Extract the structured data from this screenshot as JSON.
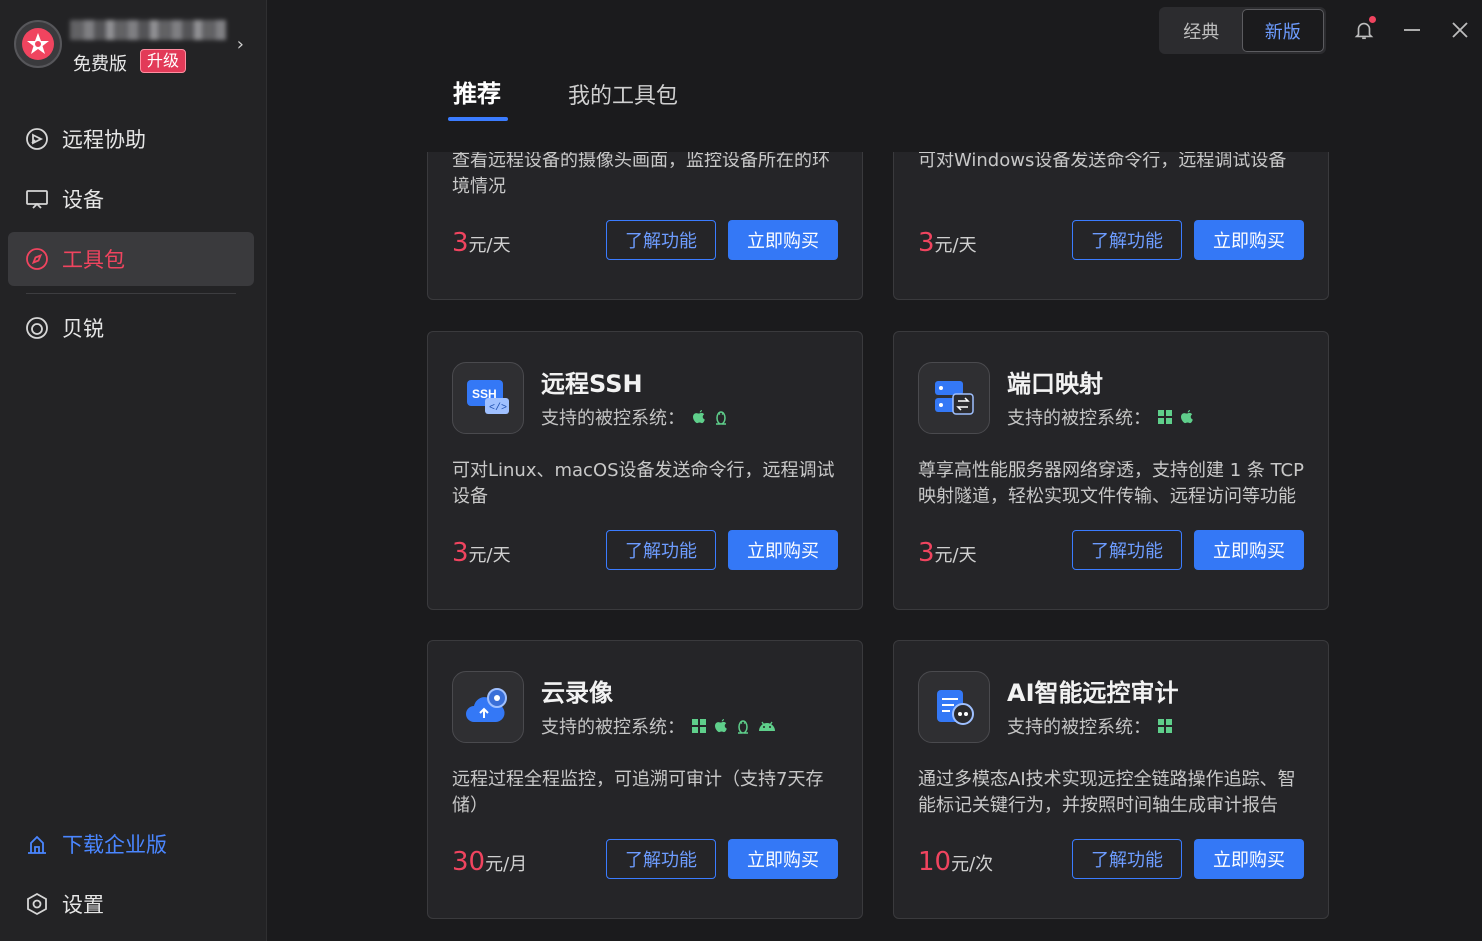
{
  "colors": {
    "accent": "#3b7cff",
    "brand": "#f0445f",
    "bg": "#1b1b1d",
    "sidebar": "#232325"
  },
  "profile": {
    "plan": "免费版",
    "upgrade": "升级"
  },
  "nav": {
    "remote_assist": "远程协助",
    "devices": "设备",
    "toolkit": "工具包",
    "beirui": "贝锐"
  },
  "bottom": {
    "download_enterprise": "下载企业版",
    "settings": "设置"
  },
  "switcher": {
    "classic": "经典",
    "new": "新版"
  },
  "tabs": {
    "recommended": "推荐",
    "my_toolkit": "我的工具包"
  },
  "cards": [
    {
      "title": "",
      "systems_label": "",
      "desc": "查看远程设备的摄像头画面，监控设备所在的环境情况",
      "price_num": "3",
      "price_unit": "元/天",
      "learn": "了解功能",
      "buy": "立即购买"
    },
    {
      "title": "",
      "systems_label": "",
      "desc": "可对Windows设备发送命令行，远程调试设备",
      "price_num": "3",
      "price_unit": "元/天",
      "learn": "了解功能",
      "buy": "立即购买"
    },
    {
      "title": "远程SSH",
      "icon": "ssh-icon",
      "systems_label": "支持的被控系统：",
      "systems": [
        "apple-icon",
        "linux-icon"
      ],
      "desc": "可对Linux、macOS设备发送命令行，远程调试设备",
      "price_num": "3",
      "price_unit": "元/天",
      "learn": "了解功能",
      "buy": "立即购买"
    },
    {
      "title": "端口映射",
      "icon": "port-mapping-icon",
      "systems_label": "支持的被控系统：",
      "systems": [
        "windows-icon",
        "apple-icon"
      ],
      "desc": "尊享高性能服务器网络穿透，支持创建 1 条 TCP 映射隧道，轻松实现文件传输、远程访问等功能",
      "price_num": "3",
      "price_unit": "元/天",
      "learn": "了解功能",
      "buy": "立即购买"
    },
    {
      "title": "云录像",
      "icon": "cloud-recording-icon",
      "systems_label": "支持的被控系统：",
      "systems": [
        "windows-icon",
        "apple-icon",
        "linux-icon",
        "android-icon"
      ],
      "desc": "远程过程全程监控，可追溯可审计（支持7天存储）",
      "price_num": "30",
      "price_unit": "元/月",
      "learn": "了解功能",
      "buy": "立即购买"
    },
    {
      "title": "AI智能远控审计",
      "icon": "ai-audit-icon",
      "systems_label": "支持的被控系统：",
      "systems": [
        "windows-icon"
      ],
      "desc": "通过多模态AI技术实现远控全链路操作追踪、智能标记关键行为，并按照时间轴生成审计报告",
      "price_num": "10",
      "price_unit": "元/次",
      "learn": "了解功能",
      "buy": "立即购买"
    }
  ]
}
